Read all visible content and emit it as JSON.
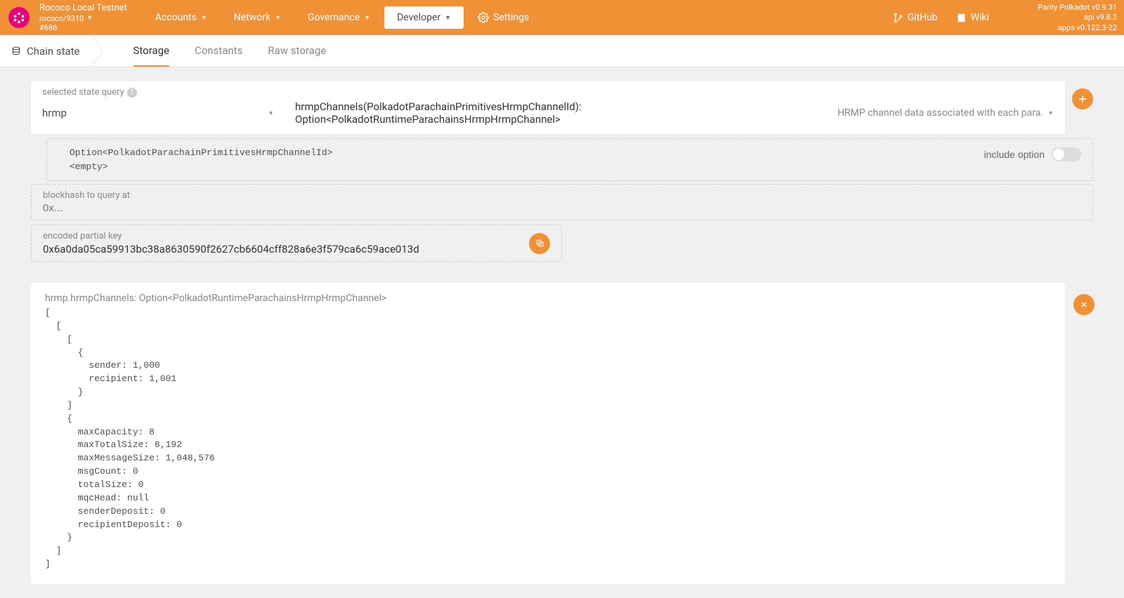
{
  "chain": {
    "name": "Rococo Local Testnet",
    "spec": "rococo/9310",
    "block": "#686"
  },
  "topnav": {
    "accounts": "Accounts",
    "network": "Network",
    "governance": "Governance",
    "developer": "Developer",
    "settings": "Settings"
  },
  "extlinks": {
    "github": "GitHub",
    "wiki": "Wiki"
  },
  "versions": {
    "line1": "Parity Polkadot v0.9.31",
    "line2": "api v9.8.2",
    "line3": "apps v0.122.3-22"
  },
  "subnav": {
    "crumb": "Chain state",
    "storage": "Storage",
    "constants": "Constants",
    "raw": "Raw storage"
  },
  "query": {
    "label": "selected state query",
    "module": "hrmp",
    "method": "hrmpChannels(PolkadotParachainPrimitivesHrmpChannelId): Option<PolkadotRuntimeParachainsHrmpHrmpChannel>",
    "doc": "HRMP channel data associated with each para."
  },
  "param": {
    "type": "Option<PolkadotParachainPrimitivesHrmpChannelId>",
    "value": "<empty>",
    "include_label": "include option"
  },
  "blockhash": {
    "label": "blockhash to query at",
    "placeholder": "0x..."
  },
  "partialkey": {
    "label": "encoded partial key",
    "value": "0x6a0da05ca59913bc38a8630590f2627cb6604cff828a6e3f579ca6c59ace013d"
  },
  "result": {
    "title": "hrmp.hrmpChannels: Option<PolkadotRuntimeParachainsHrmpHrmpChannel>",
    "body": "[\n  [\n    [\n      {\n        sender: 1,000\n        recipient: 1,001\n      }\n    ]\n    {\n      maxCapacity: 8\n      maxTotalSize: 8,192\n      maxMessageSize: 1,048,576\n      msgCount: 0\n      totalSize: 0\n      mqcHead: null\n      senderDeposit: 0\n      recipientDeposit: 0\n    }\n  ]\n]"
  }
}
